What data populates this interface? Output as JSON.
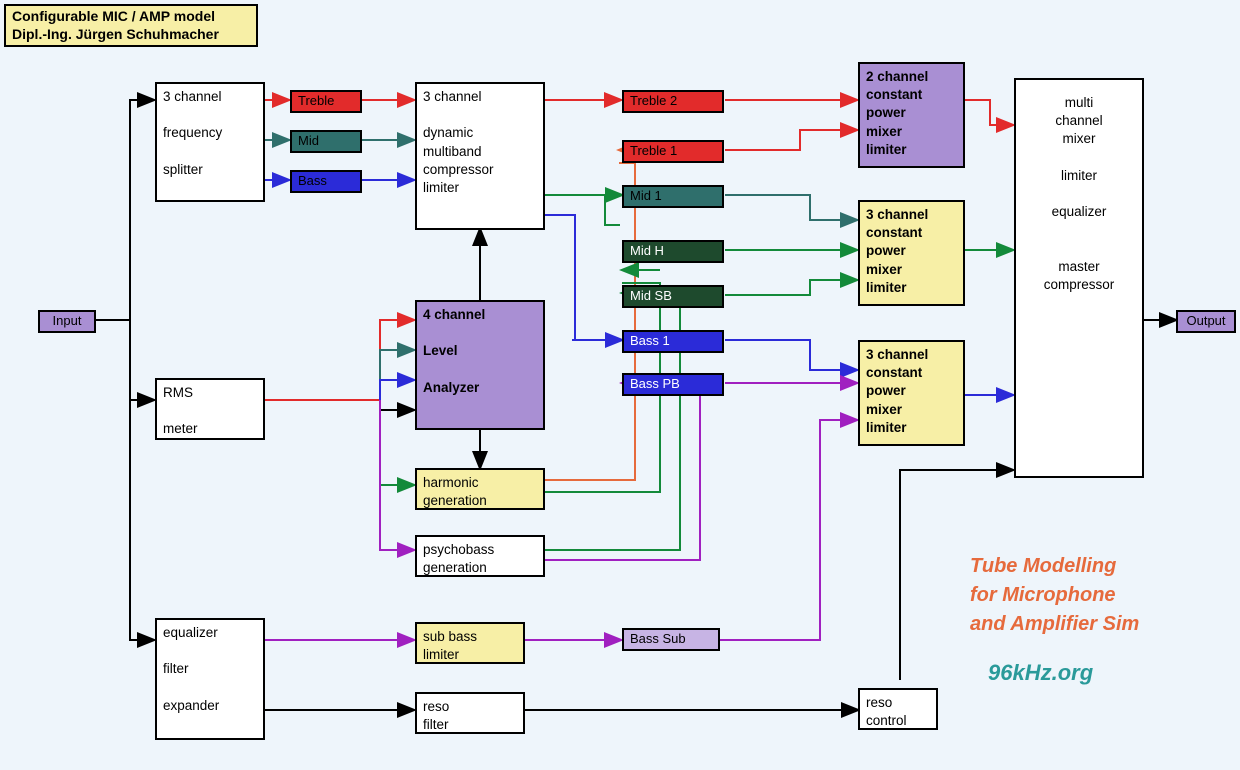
{
  "title": {
    "line1": "Configurable MIC / AMP model",
    "line2": "Dipl.-Ing. Jürgen Schuhmacher"
  },
  "io": {
    "input": "Input",
    "output": "Output"
  },
  "blocks": {
    "splitter": "3 channel\n\nfrequency\n\nsplitter",
    "rms": "RMS\n\nmeter",
    "eq_filter": "equalizer\n\nfilter\n\nexpander",
    "dyn_comp": "3 channel\n\ndynamic\nmultiband\ncompressor\nlimiter",
    "analyzer": "4 channel\n\nLevel\n\nAnalyzer",
    "harm": "harmonic\ngeneration",
    "psycho": "psychobass\ngeneration",
    "subbass": "sub bass\nlimiter",
    "reso_f": "reso\nfilter",
    "mixT": "2 channel\nconstant\npower\nmixer\nlimiter",
    "mixM": "3 channel\nconstant\npower\nmixer\nlimiter",
    "mixB": "3 channel\nconstant\npower\nmixer\nlimiter",
    "master": "multi\nchannel\nmixer\n\nlimiter\n\nequalizer\n\n\nmaster\ncompressor",
    "reso_c": "reso\ncontrol"
  },
  "bands": {
    "treble": "Treble",
    "mid": "Mid",
    "bass": "Bass",
    "treble2": "Treble 2",
    "treble1": "Treble 1",
    "mid1": "Mid 1",
    "midH": "Mid H",
    "midSB": "Mid SB",
    "bass1": "Bass 1",
    "bassPB": "Bass PB",
    "bassSub": "Bass Sub"
  },
  "credits": {
    "line1": "Tube Modelling",
    "line2": "for Microphone",
    "line3": "and Amplifier Sim",
    "site": "96kHz.org"
  },
  "colors": {
    "red": "#e22b2b",
    "teal": "#2f6f6c",
    "darkGreen": "#1e4a2d",
    "blue": "#2b2bd8",
    "purple": "#a98fd3",
    "cream": "#f7efa6",
    "lilac": "#c7b4e4",
    "orange": "#e66a3c",
    "green": "#138a3a",
    "magenta": "#a020c0",
    "black": "#000"
  }
}
